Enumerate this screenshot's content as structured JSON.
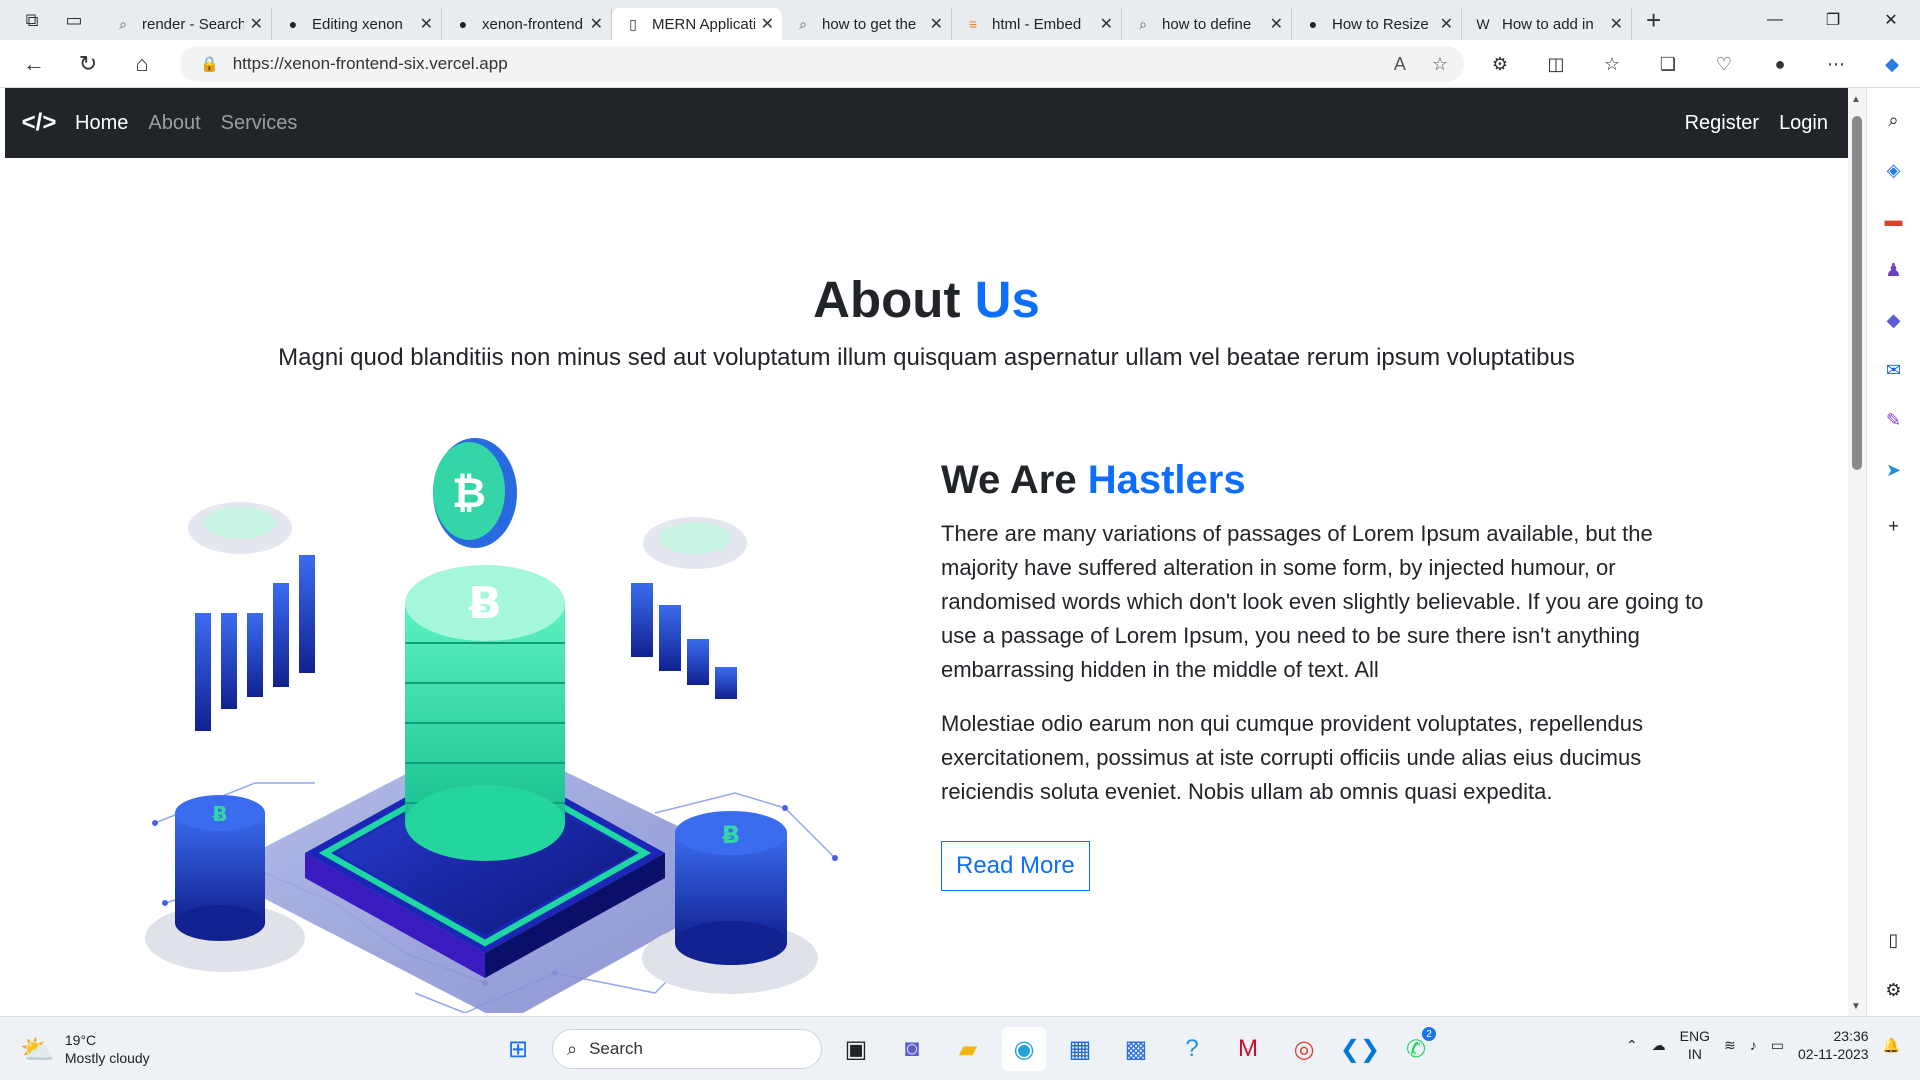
{
  "browser": {
    "tabs": [
      {
        "title": "render - Search",
        "icon": "search-icon",
        "active": false
      },
      {
        "title": "Editing xenon",
        "icon": "github-icon",
        "active": false
      },
      {
        "title": "xenon-frontend",
        "icon": "github-icon",
        "active": false
      },
      {
        "title": "MERN Application",
        "icon": "page-icon",
        "active": true
      },
      {
        "title": "how to get the",
        "icon": "search-icon",
        "active": false
      },
      {
        "title": "html - Embed",
        "icon": "stackoverflow-icon",
        "active": false
      },
      {
        "title": "how to define",
        "icon": "search-icon",
        "active": false
      },
      {
        "title": "How to Resize",
        "icon": "github-icon",
        "active": false
      },
      {
        "title": "How to add in",
        "icon": "wikipedia-icon",
        "active": false
      }
    ],
    "url": "https://xenon-frontend-six.vercel.app"
  },
  "site": {
    "nav": {
      "brand": "</>",
      "links": [
        "Home",
        "About",
        "Services"
      ],
      "right_links": [
        "Register",
        "Login"
      ]
    },
    "about": {
      "title_main": "About",
      "title_accent": "Us",
      "subtitle": "Magni quod blanditiis non minus sed aut voluptatum illum quisquam aspernatur ullam vel beatae rerum ipsum voluptatibus"
    },
    "section": {
      "heading_main": "We Are",
      "heading_accent": "Hastlers",
      "paragraph1": "There are many variations of passages of Lorem Ipsum available, but the majority have suffered alteration in some form, by injected humour, or randomised words which don't look even slightly believable. If you are going to use a passage of Lorem Ipsum, you need to be sure there isn't anything embarrassing hidden in the middle of text. All",
      "paragraph2": "Molestiae odio earum non qui cumque provident voluptates, repellendus exercitationem, possimus at iste corrupti officiis unde alias eius ducimus reiciendis soluta eveniet. Nobis ullam ab omnis quasi expedita.",
      "button": "Read More"
    }
  },
  "taskbar": {
    "weather_temp": "19°C",
    "weather_desc": "Mostly cloudy",
    "search_placeholder": "Search",
    "lang_line1": "ENG",
    "lang_line2": "IN",
    "time": "23:36",
    "date": "02-11-2023",
    "badge_count": "2"
  },
  "colors": {
    "accent": "#0d6efd",
    "navbar": "#212529"
  }
}
